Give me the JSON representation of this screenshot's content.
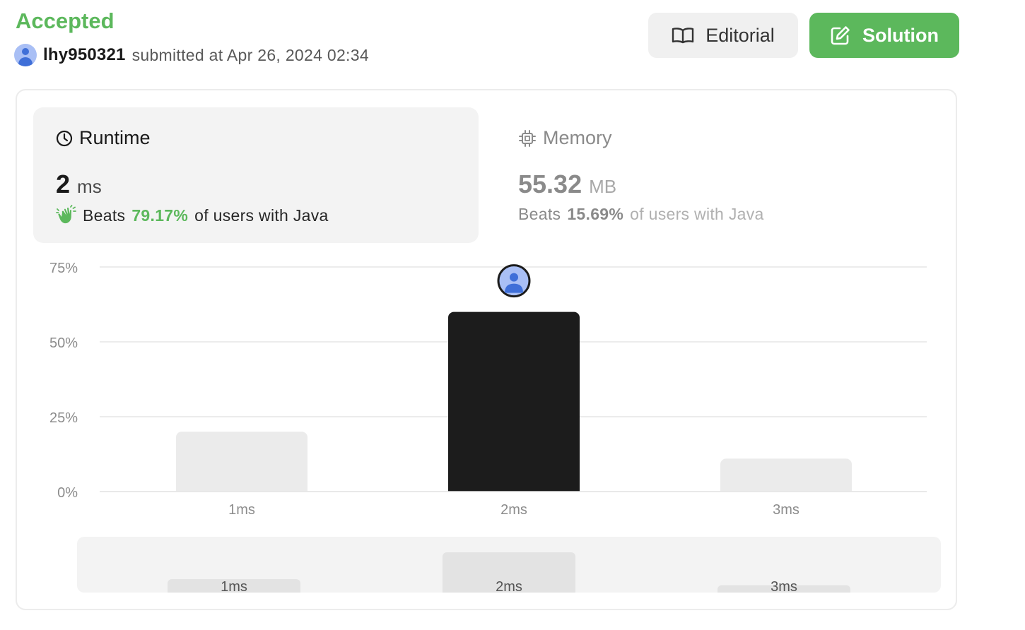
{
  "header": {
    "status": "Accepted",
    "username": "lhy950321",
    "submitted": "submitted at Apr 26, 2024 02:34"
  },
  "actions": {
    "editorial_label": "Editorial",
    "solution_label": "Solution"
  },
  "runtime": {
    "title": "Runtime",
    "value": "2",
    "unit": "ms",
    "beats_label": "Beats",
    "beats_pct": "79.17%",
    "beats_tail": "of users with Java"
  },
  "memory": {
    "title": "Memory",
    "value": "55.32",
    "unit": "MB",
    "beats_label": "Beats",
    "beats_pct": "15.69%",
    "beats_tail": "of users with Java"
  },
  "colors": {
    "accent": "#5cb85c",
    "selected_bar": "#1c1c1c",
    "other_bar": "#ebebeb",
    "mini_bar": "#e3e3e3"
  },
  "chart_data": {
    "type": "bar",
    "categories": [
      "1ms",
      "2ms",
      "3ms"
    ],
    "values": [
      20,
      60,
      11
    ],
    "selected_category": "2ms",
    "yticks": [
      "75%",
      "50%",
      "25%",
      "0%"
    ],
    "ytick_values": [
      75,
      50,
      25,
      0
    ],
    "ylim": [
      0,
      75
    ],
    "grid": true,
    "overview": {
      "categories": [
        "1ms",
        "2ms",
        "3ms"
      ],
      "values": [
        20,
        60,
        11
      ]
    }
  }
}
